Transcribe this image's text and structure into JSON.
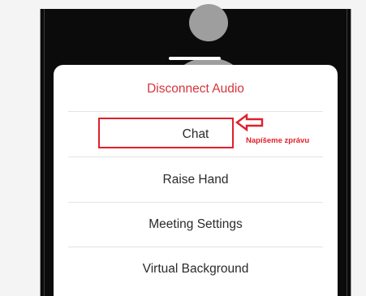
{
  "menu": {
    "items": [
      {
        "label": "Disconnect Audio"
      },
      {
        "label": "Chat"
      },
      {
        "label": "Raise Hand"
      },
      {
        "label": "Meeting Settings"
      },
      {
        "label": "Virtual Background"
      }
    ]
  },
  "annotation": {
    "text": "Napíšeme zprávu"
  },
  "colors": {
    "danger": "#d5353c",
    "annotation": "#e0202a"
  }
}
